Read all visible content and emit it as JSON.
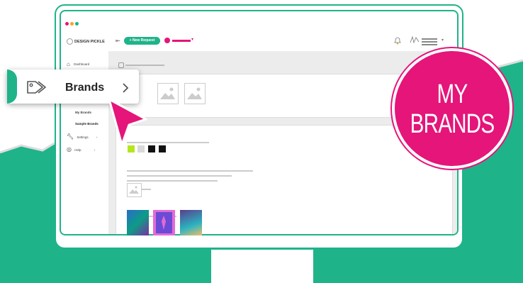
{
  "app": {
    "logo_text": "DESIGN PICKLE",
    "new_request_label": "+ New Request"
  },
  "sidebar": {
    "items": [
      {
        "label": "Dashboard"
      },
      {
        "label": "My Brands"
      },
      {
        "label": "Sample Brands"
      },
      {
        "label": "Settings"
      },
      {
        "label": "Help"
      }
    ]
  },
  "callout": {
    "label": "Brands"
  },
  "badge": {
    "line1": "MY",
    "line2": "BRANDS"
  },
  "colors": {
    "brand_green": "#1fb38a",
    "brand_pink": "#e5157a",
    "swatches": [
      "#b5e61d",
      "#d9d9d9",
      "#111111",
      "#111111"
    ]
  }
}
